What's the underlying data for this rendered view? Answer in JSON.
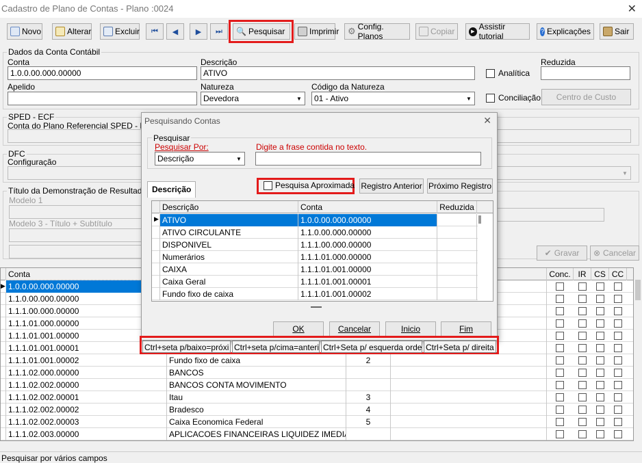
{
  "window": {
    "title": "Cadastro de Plano de Contas - Plano :0024"
  },
  "toolbar": {
    "novo": "Novo",
    "alterar": "Alterar",
    "excluir": "Excluir",
    "pesquisar": "Pesquisar",
    "imprimir": "Imprimir",
    "config": "Config. Planos",
    "copiar": "Copiar",
    "assistir": "Assistir tutorial",
    "explicacoes": "Explicações",
    "sair": "Sair"
  },
  "dados": {
    "group": "Dados da Conta Contábil",
    "conta_label": "Conta",
    "conta_value": "1.0.0.00.000.00000",
    "descricao_label": "Descrição",
    "descricao_value": "ATIVO",
    "analitica": "Analítica",
    "reduzida_label": "Reduzida",
    "reduzida_value": "",
    "apelido_label": "Apelido",
    "apelido_value": "",
    "natureza_label": "Natureza",
    "natureza_value": "Devedora",
    "codnat_label": "Código da Natureza",
    "codnat_value": "01 - Ativo",
    "conciliacao": "Conciliação",
    "centro_custo": "Centro de Custo"
  },
  "sped": {
    "group": "SPED - ECF",
    "label": "Conta do Plano Referencial SPED - ECF"
  },
  "dfc": {
    "group": "DFC",
    "label": "Configuração"
  },
  "dre": {
    "group": "Título da Demonstração de Resultado",
    "modelo1": "Modelo 1",
    "modelo3": "Modelo 3 - Título + Subtítulo"
  },
  "actions": {
    "gravar": "Gravar",
    "cancelar": "Cancelar"
  },
  "main_grid": {
    "headers": {
      "conta": "Conta",
      "conc": "Conc.",
      "ir": "IR",
      "cs": "CS",
      "cc": "CC"
    },
    "rows": [
      {
        "conta": "1.0.0.00.000.00000",
        "desc": "",
        "red": ""
      },
      {
        "conta": "1.1.0.00.000.00000",
        "desc": "",
        "red": ""
      },
      {
        "conta": "1.1.1.00.000.00000",
        "desc": "",
        "red": ""
      },
      {
        "conta": "1.1.1.01.000.00000",
        "desc": "",
        "red": ""
      },
      {
        "conta": "1.1.1.01.001.00000",
        "desc": "",
        "red": ""
      },
      {
        "conta": "1.1.1.01.001.00001",
        "desc": "",
        "red": ""
      },
      {
        "conta": "1.1.1.01.001.00002",
        "desc": "Fundo fixo de caixa",
        "red": "2"
      },
      {
        "conta": "1.1.1.02.000.00000",
        "desc": "BANCOS",
        "red": ""
      },
      {
        "conta": "1.1.1.02.002.00000",
        "desc": "BANCOS CONTA MOVIMENTO",
        "red": ""
      },
      {
        "conta": "1.1.1.02.002.00001",
        "desc": "Itau",
        "red": "3"
      },
      {
        "conta": "1.1.1.02.002.00002",
        "desc": "Bradesco",
        "red": "4"
      },
      {
        "conta": "1.1.1.02.002.00003",
        "desc": "Caixa Economica Federal",
        "red": "5"
      },
      {
        "conta": "1.1.1.02.003.00000",
        "desc": "APLICACOES FINANCEIRAS LIQUIDEZ IMEDIATA",
        "red": ""
      }
    ]
  },
  "dialog": {
    "title": "Pesquisando Contas",
    "pesquisar_group": "Pesquisar",
    "pesquisar_por_label": "Pesquisar Por:",
    "pesquisar_por_value": "Descrição",
    "frase_label": "Digite a frase contida no texto.",
    "frase_value": "",
    "tab": "Descrição",
    "aproximada": "Pesquisa Aproximada",
    "registro_anterior": "Registro Anterior",
    "proximo_registro": "Próximo Registro",
    "headers": {
      "descricao": "Descrição",
      "conta": "Conta",
      "reduzida": "Reduzida"
    },
    "rows": [
      {
        "desc": "ATIVO",
        "conta": "1.0.0.00.000.00000",
        "red": ""
      },
      {
        "desc": "ATIVO CIRCULANTE",
        "conta": "1.1.0.00.000.00000",
        "red": ""
      },
      {
        "desc": "DISPONIVEL",
        "conta": "1.1.1.00.000.00000",
        "red": ""
      },
      {
        "desc": "Numerários",
        "conta": "1.1.1.01.000.00000",
        "red": ""
      },
      {
        "desc": "CAIXA",
        "conta": "1.1.1.01.001.00000",
        "red": ""
      },
      {
        "desc": "Caixa Geral",
        "conta": "1.1.1.01.001.00001",
        "red": ""
      },
      {
        "desc": "Fundo fixo de caixa",
        "conta": "1.1.1.01.001.00002",
        "red": ""
      }
    ],
    "ok": "OK",
    "cancelar": "Cancelar",
    "inicio": "Inicio",
    "fim": "Fim"
  },
  "hints": [
    "Ctrl+seta p/baixo=próxi",
    "Ctrl+seta p/cima=anterio",
    "Ctrl+Seta p/ esquerda orden",
    "Ctrl+Seta p/ direita"
  ],
  "status": "Pesquisar por vários campos",
  "colors": {
    "selection": "#0078d7",
    "highlight_border": "#e31b1b",
    "link_red": "#cc0000"
  }
}
